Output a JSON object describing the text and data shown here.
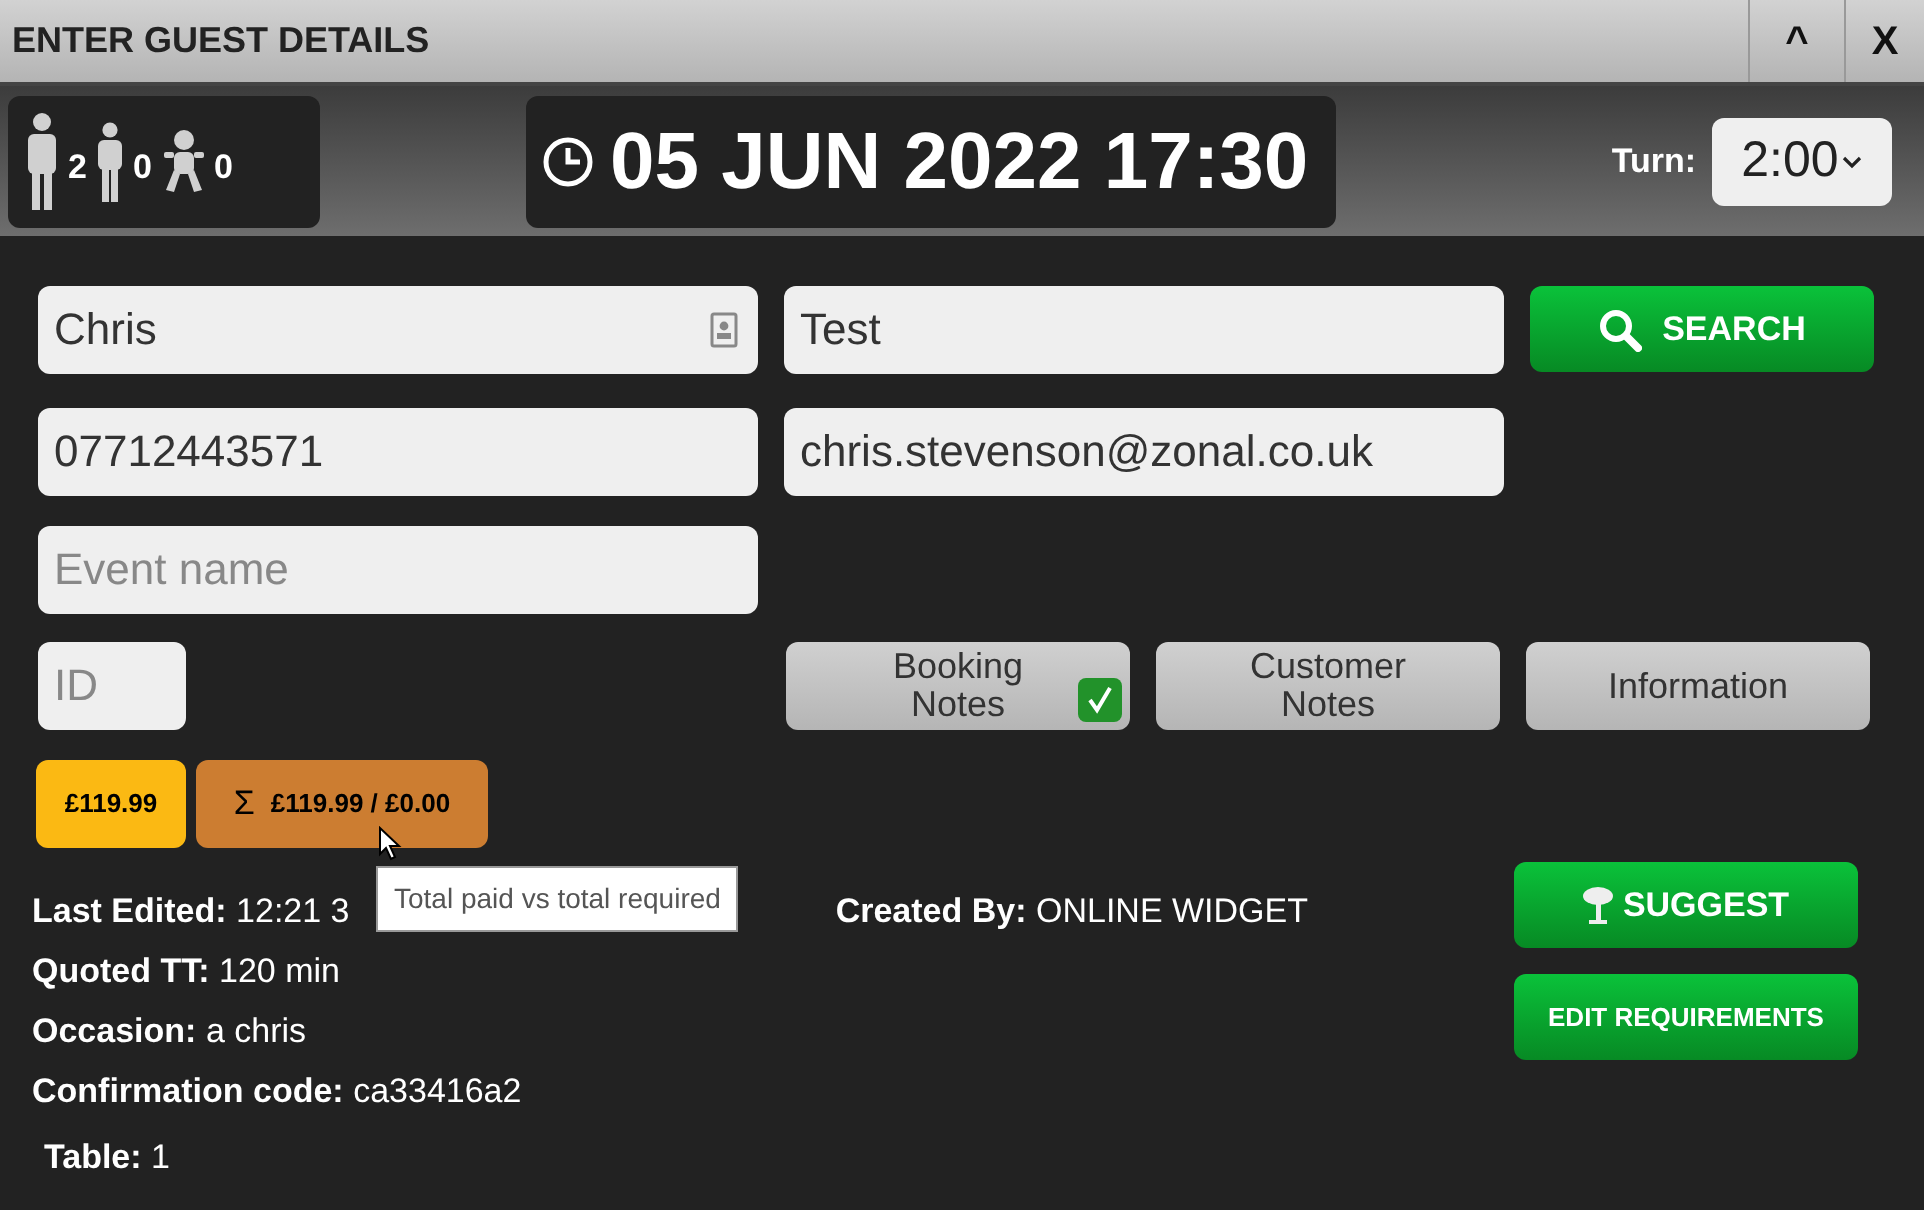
{
  "window": {
    "title": "ENTER GUEST DETAILS",
    "buttons": [
      {
        "kind": "collapse",
        "label": "^"
      },
      {
        "kind": "close",
        "label": "X"
      }
    ]
  },
  "covers": [
    {
      "kind": "adult",
      "count": "2"
    },
    {
      "kind": "child",
      "count": "0"
    },
    {
      "kind": "baby",
      "count": "0"
    }
  ],
  "date_time": "05 JUN 2022 17:30",
  "turn": {
    "label": "Turn:",
    "value": "2:00"
  },
  "fields": {
    "first_name": {
      "value": "Chris"
    },
    "last_name": {
      "value": "Test"
    },
    "phone": {
      "value": "07712443571"
    },
    "email": {
      "value": "chris.stevenson@zonal.co.uk"
    },
    "event_name": {
      "placeholder": "Event name"
    },
    "id": {
      "placeholder": "ID"
    }
  },
  "search_button": "SEARCH",
  "notes_buttons": [
    {
      "label": "Booking\nNotes",
      "checked": true
    },
    {
      "label": "Customer\nNotes",
      "checked": false
    },
    {
      "label": "Information",
      "checked": false
    }
  ],
  "payments": {
    "deposit": "£119.99",
    "sigma": "Σ",
    "total": "£119.99 / £0.00"
  },
  "tooltip": "Total paid vs total required",
  "details": [
    {
      "label": "Last Edited:",
      "value": "12:21 3"
    },
    {
      "label": "Quoted TT:",
      "value": "120 min"
    },
    {
      "label": "Occasion:",
      "value": "a chris"
    },
    {
      "label": "Confirmation code:",
      "value": "ca33416a2"
    },
    {
      "label": "Table:",
      "value": "1"
    }
  ],
  "created_by": {
    "label": "Created By:",
    "value": "ONLINE WIDGET"
  },
  "action_buttons": [
    "SUGGEST",
    "EDIT REQUIREMENTS"
  ]
}
